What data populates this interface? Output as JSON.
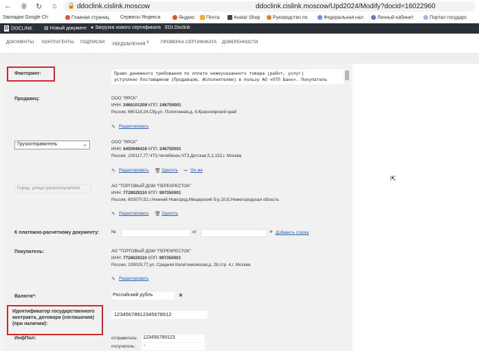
{
  "browser": {
    "url_host": "ddoclink.cislink.moscow",
    "url_full": "ddoclink.cislink.moscow/Upd2024/Modify?docid=16022960",
    "bookmarks": [
      "Закладки Google Ch",
      "Главная страниц",
      "Сервисы Яндекса",
      "Яндекс",
      "Почта",
      "Avatar Shop",
      "Руководство по",
      "Федеральная нал",
      "Личный кабинет",
      "Портал государс"
    ]
  },
  "app": {
    "brand": "DOCLINK",
    "header_items": [
      "Новый документ",
      "Загрузка нового сертификата",
      "EDI.Doclink"
    ],
    "menu": [
      {
        "label": "ДОКУМЕНТЫ"
      },
      {
        "label": "КОНТРАГЕНТЫ"
      },
      {
        "label": "ПОДПИСКИ"
      },
      {
        "label": "УВЕДОМЛЕНИЯ",
        "badge": "0"
      },
      {
        "label": "ПРОВЕРКА СЕРТИФИКАТА"
      },
      {
        "label": "ДОВЕРЕННОСТИ"
      }
    ]
  },
  "form": {
    "factoring": {
      "label": "Факторинг:",
      "text_line1": "Право денежного требования по оплате нижеуказанного товара (работ, услуг)",
      "text_line2": "уступлено Поставщиком (Продавцом, Исполнителем) в пользу АО «ОТП Банк». Покупатель"
    },
    "seller": {
      "label": "Продавец:",
      "name": "ООО \"ЯРСК\"",
      "inn_label": "ИНН:",
      "inn": "2466101209",
      "kpp_label": "КПП:",
      "kpp": "246750001",
      "address": "Россия, 660118,24,Сбу,ул. Полигонная,д. 8,Красноярский край",
      "edit": "Редактировать"
    },
    "shipper": {
      "select_value": "Грузоотправитель",
      "name": "ООО \"ЯРСК\"",
      "inn_label": "ИНН:",
      "inn": "6450946416",
      "kpp_label": "КПП:",
      "kpp": "246750001",
      "address": "Россия, 109117,77,ЧТЗ,Челябинск,ЧТЗ,Детская,5,2,152,г. Москва",
      "edit": "Редактировать",
      "delete": "Удалить",
      "same": "Он же"
    },
    "consignee": {
      "placeholder": "Город, улица грузополучателя",
      "name": "АО \"ТОРГОВЫЙ ДОМ \"ПЕРЕКРЕСТОК\"",
      "inn_label": "ИНН:",
      "inn": "7728029110",
      "kpp_label": "КПП:",
      "kpp": "997350001",
      "address": "Россия, 603070,52,г.Нижний Новгород,Мещерский б-р,10,Б,Нижегородская область",
      "edit": "Редактировать",
      "delete": "Удалить"
    },
    "payment_doc": {
      "label": "К платежно-расчетному документу:",
      "num_label": "№",
      "from_label": "от",
      "add": "Добавить строку"
    },
    "buyer": {
      "label": "Покупатель:",
      "name": "АО \"ТОРГОВЫЙ ДОМ \"ПЕРЕКРЕСТОК\"",
      "inn_label": "ИНН:",
      "inn": "7728029110",
      "kpp_label": "КПП:",
      "kpp": "997350001",
      "address": "Россия, 109029,77,ул. Средняя Калитниковская,д. 28,стр. 4,г. Москва",
      "edit": "Редактировать"
    },
    "currency": {
      "label": "Валюта*:",
      "value": "Российский рубль",
      "clear": "✖"
    },
    "gov_contract": {
      "label_line1": "Идентификатор государственного",
      "label_line2": "контракта, договора (соглашения)",
      "label_line3": "(при наличии):",
      "value": "12345678912345678912"
    },
    "info_pol": {
      "label": "ИнфПол:",
      "sender_label": "отправитель:",
      "sender_value": "123456789123",
      "receiver_label": "получатель:",
      "receiver_value": "-"
    }
  },
  "colors": {
    "accent_red": "#d0262e",
    "link": "#2a5db0",
    "header_bg": "#2b2f38"
  }
}
